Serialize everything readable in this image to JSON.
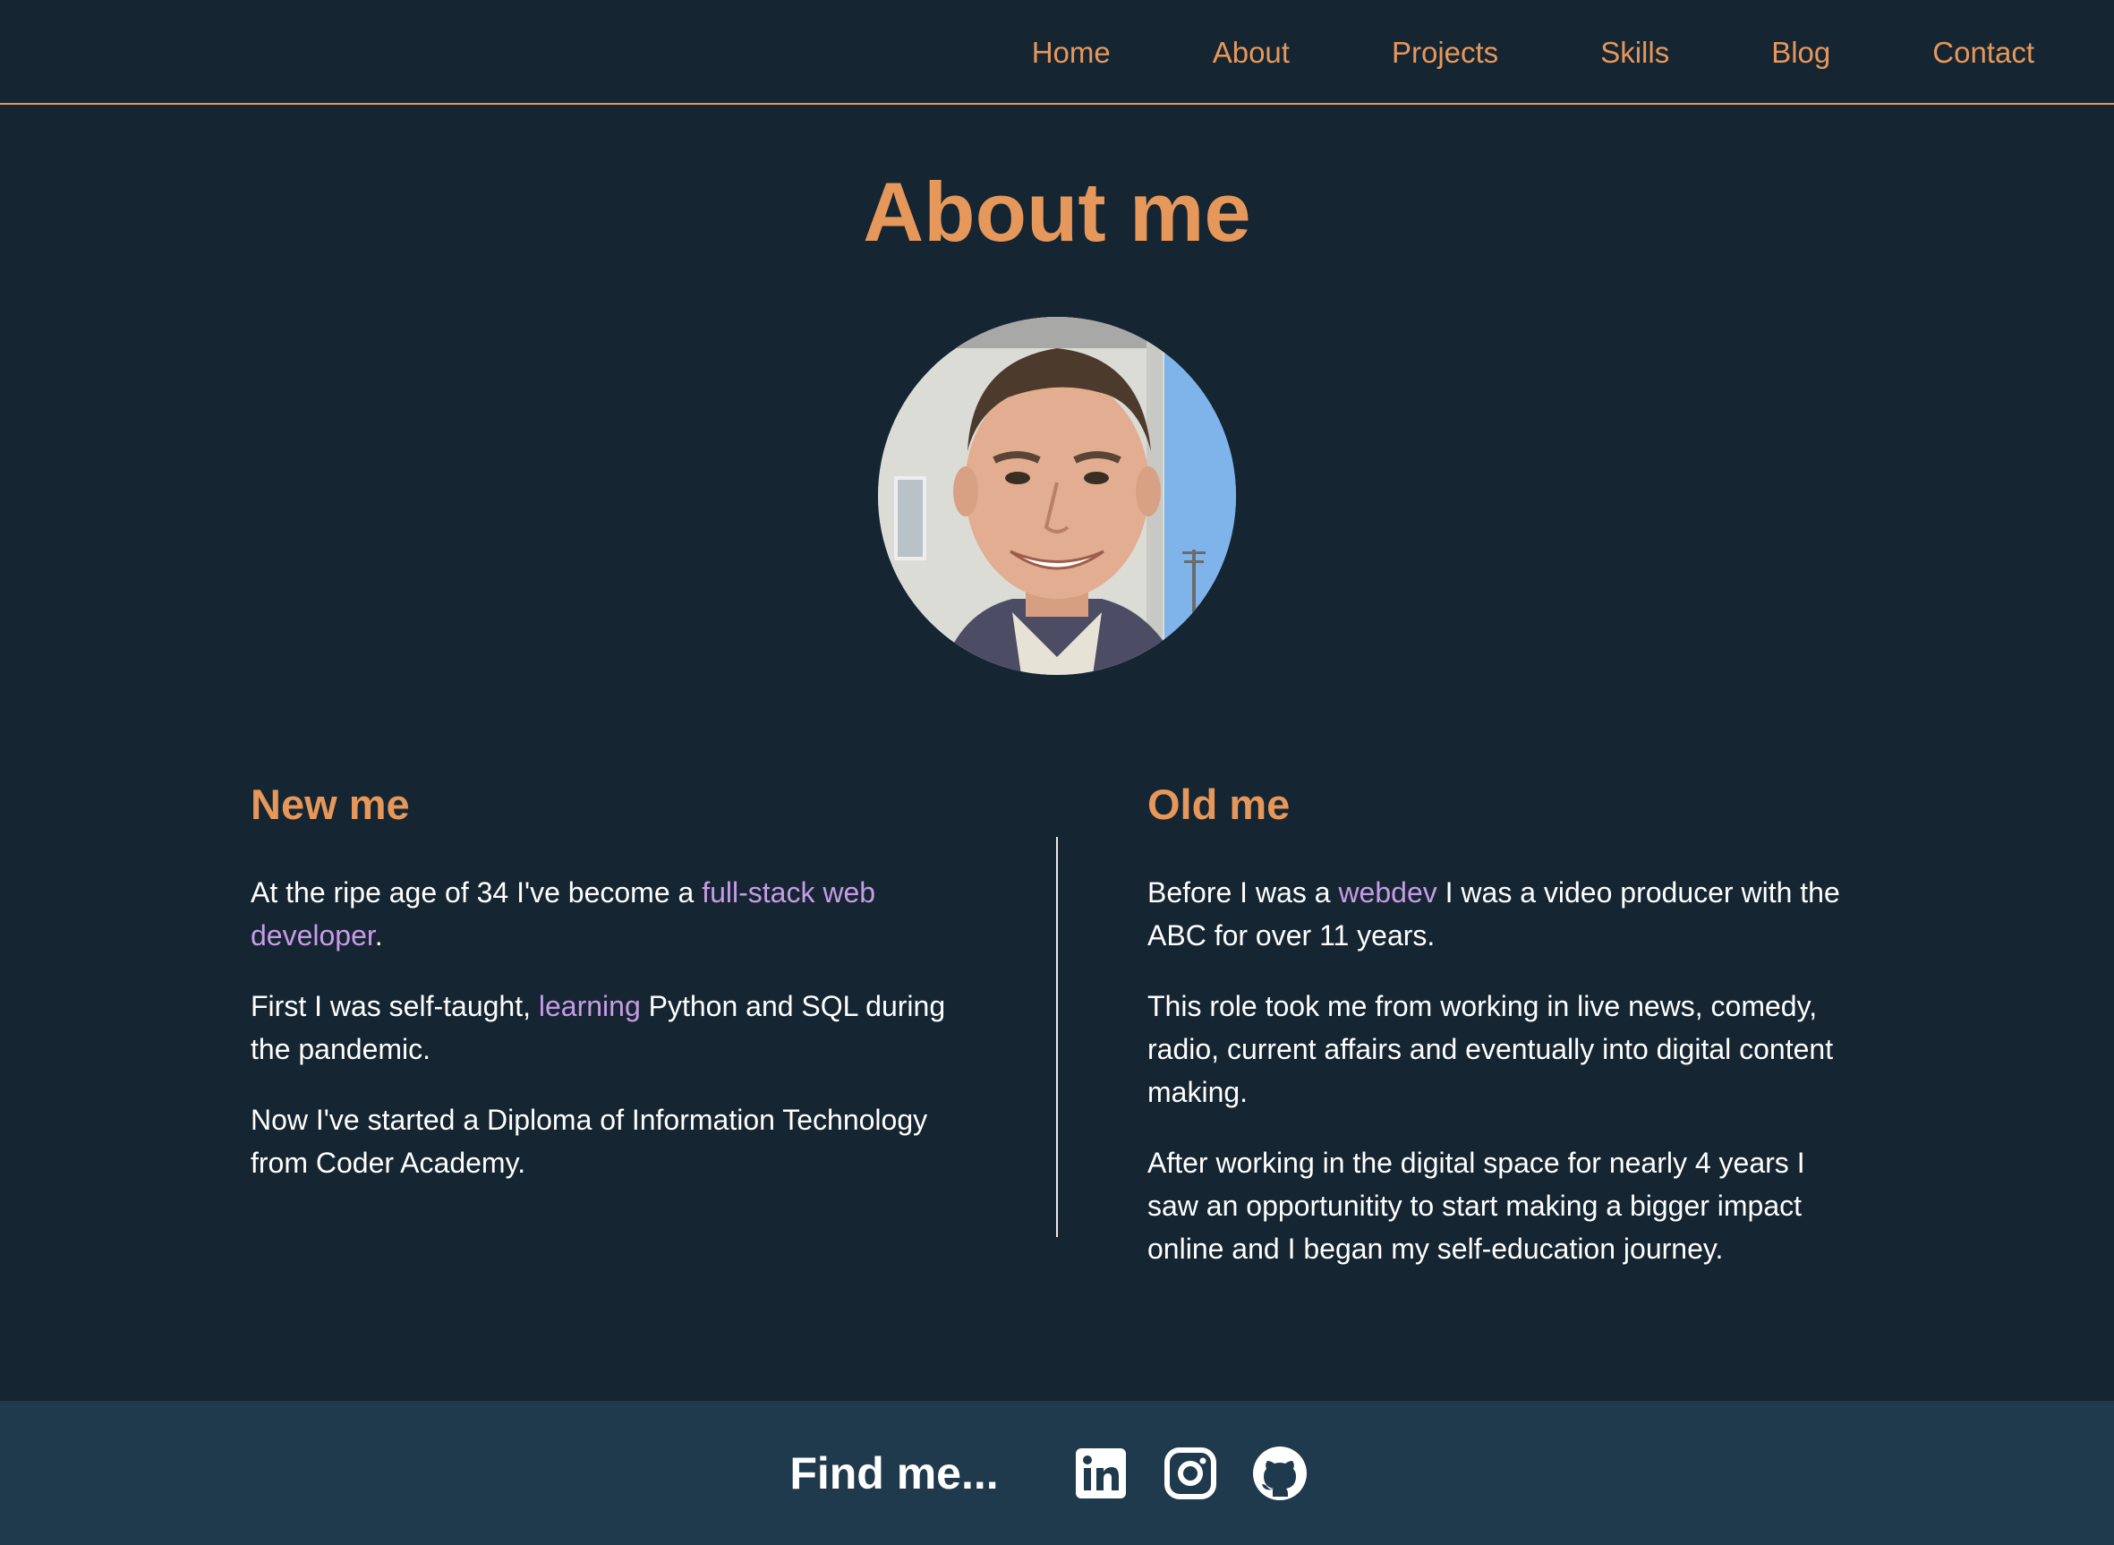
{
  "nav": {
    "items": [
      {
        "label": "Home"
      },
      {
        "label": "About"
      },
      {
        "label": "Projects"
      },
      {
        "label": "Skills"
      },
      {
        "label": "Blog"
      },
      {
        "label": "Contact"
      }
    ]
  },
  "main": {
    "title": "About me",
    "avatar_icon": "portrait-photo",
    "new_me": {
      "heading": "New me",
      "p1_before": "At the ripe age of 34 I've become a ",
      "p1_link": "full-stack web developer",
      "p1_after": ".",
      "p2_before": "First I was self-taught, ",
      "p2_link": "learning",
      "p2_after": " Python and SQL during the pandemic.",
      "p3": "Now I've started a Diploma of Information Technology from Coder Academy."
    },
    "old_me": {
      "heading": "Old me",
      "p1_before": "Before I was a ",
      "p1_link": "webdev",
      "p1_after": " I was a video producer with the ABC for over 11 years.",
      "p2": "This role took me from working in live news, comedy, radio, current affairs and eventually into digital content making.",
      "p3": "After working in the digital space for nearly 4 years I saw an opportunitity to start making a bigger impact online and I began my self-education journey."
    }
  },
  "footer": {
    "label": "Find me...",
    "icons": [
      "linkedin-icon",
      "instagram-icon",
      "github-icon"
    ]
  },
  "colors": {
    "background": "#152532",
    "accent": "#e6975a",
    "link": "#c79ce6",
    "footer": "#1f394d"
  }
}
